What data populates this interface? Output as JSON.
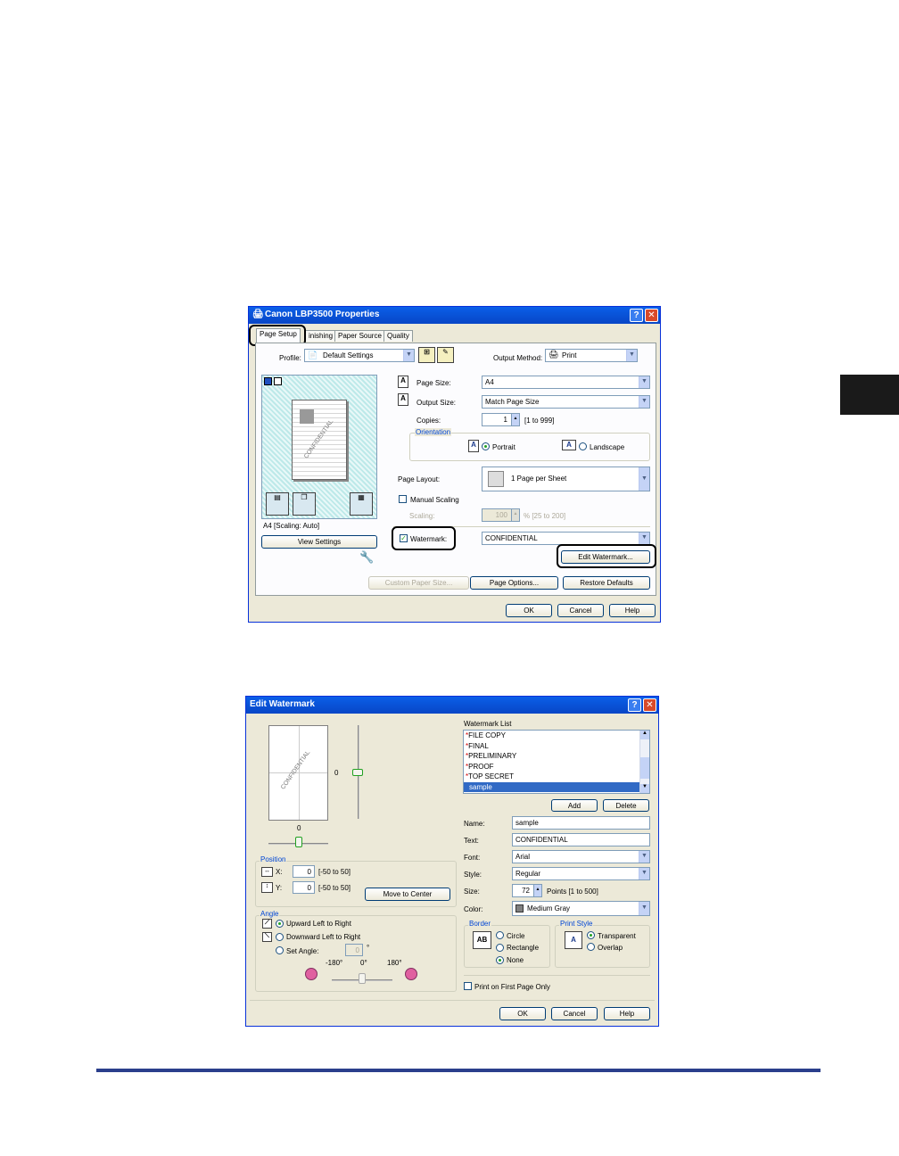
{
  "props": {
    "title": "Canon LBP3500 Properties",
    "tabs": [
      "Page Setup",
      "inishing",
      "Paper Source",
      "Quality"
    ],
    "profile_label": "Profile:",
    "profile_value": "Default Settings",
    "output_method_label": "Output Method:",
    "output_method_value": "Print",
    "page_size_label": "Page Size:",
    "page_size_value": "A4",
    "output_size_label": "Output Size:",
    "output_size_value": "Match Page Size",
    "copies_label": "Copies:",
    "copies_value": "1",
    "copies_range": "[1 to 999]",
    "orientation_label": "Orientation",
    "portrait_label": "Portrait",
    "landscape_label": "Landscape",
    "page_layout_label": "Page Layout:",
    "page_layout_value": "1 Page per Sheet",
    "manual_scaling_label": "Manual Scaling",
    "scaling_label": "Scaling:",
    "scaling_value": "100",
    "scaling_range": "% [25 to 200]",
    "watermark_label": "Watermark:",
    "watermark_value": "CONFIDENTIAL",
    "edit_watermark_btn": "Edit Watermark...",
    "preview_caption": "A4 [Scaling: Auto]",
    "preview_watermark": "CONFIDENTIAL",
    "view_settings_btn": "View Settings",
    "custom_paper_btn": "Custom Paper Size...",
    "page_options_btn": "Page Options...",
    "restore_defaults_btn": "Restore Defaults",
    "ok_btn": "OK",
    "cancel_btn": "Cancel",
    "help_btn": "Help"
  },
  "wm": {
    "title": "Edit Watermark",
    "preview_text": "CONFIDENTIAL",
    "v_slider_value": "0",
    "h_slider_value": "0",
    "list_label": "Watermark List",
    "list_items": [
      "FILE COPY",
      "FINAL",
      "PRELIMINARY",
      "PROOF",
      "TOP SECRET",
      "sample"
    ],
    "add_btn": "Add",
    "delete_btn": "Delete",
    "name_label": "Name:",
    "name_value": "sample",
    "text_label": "Text:",
    "text_value": "CONFIDENTIAL",
    "font_label": "Font:",
    "font_value": "Arial",
    "style_label": "Style:",
    "style_value": "Regular",
    "size_label": "Size:",
    "size_value": "72",
    "size_range": "Points [1 to 500]",
    "color_label": "Color:",
    "color_value": "Medium Gray",
    "position_label": "Position",
    "x_label": "X:",
    "x_value": "0",
    "x_range": "[-50 to 50]",
    "y_label": "Y:",
    "y_value": "0",
    "y_range": "[-50 to 50]",
    "move_center_btn": "Move to Center",
    "angle_label": "Angle",
    "upward_label": "Upward Left to Right",
    "downward_label": "Downward Left to Right",
    "set_angle_label": "Set Angle:",
    "set_angle_value": "0",
    "degree_unit": "°",
    "angle_min": "-180°",
    "angle_mid": "0°",
    "angle_max": "180°",
    "border_label": "Border",
    "border_icon_text": "AB",
    "circle_label": "Circle",
    "rectangle_label": "Rectangle",
    "none_label": "None",
    "print_style_label": "Print Style",
    "transparent_label": "Transparent",
    "overlap_label": "Overlap",
    "first_page_label": "Print on First Page Only",
    "ok_btn": "OK",
    "cancel_btn": "Cancel",
    "help_btn": "Help"
  },
  "colors": {
    "titlebar": "#0846c6",
    "dialog_bg": "#ece9d8",
    "group_title": "#0046d5",
    "selection": "#316ac5",
    "footer_rule": "#2b3f8c",
    "star": "#d00000"
  }
}
